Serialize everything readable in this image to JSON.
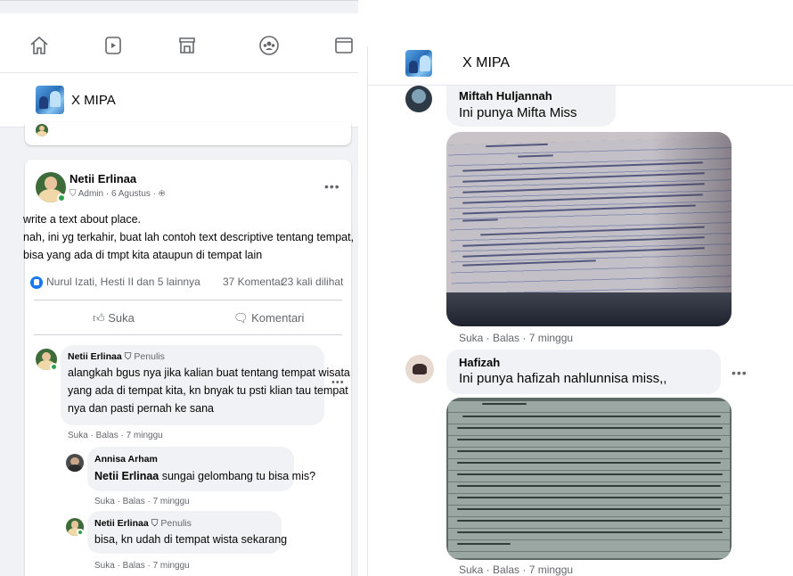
{
  "left_panel": {
    "nav": {
      "icons": [
        "home-icon",
        "watch-icon",
        "marketplace-icon",
        "groups-icon",
        "gaming-icon"
      ]
    },
    "group": {
      "name": "X MIPA"
    },
    "post": {
      "author": "Netii Erlinaa",
      "meta": "Admin · 6 Agustus · ",
      "text_lines": [
        "write a text about place.",
        "nah, ini yg terkahir, buat lah contoh text descriptive tentang tempat,",
        "bisa yang ada di tmpt kita ataupun di tempat lain"
      ],
      "reactions": "Nurul Izati, Hesti II dan 5 lainnya",
      "comments_count": "37 Komentar",
      "views": "23 kali dilihat",
      "like_label": "Suka",
      "comment_label": "Komentari"
    },
    "comments": [
      {
        "author": "Netii Erlinaa",
        "badge": "Penulis",
        "lines": [
          "alangkah bgus nya jika kalian buat tentang tempat wisata",
          "yang ada di tempat kita, kn bnyak tu psti klian tau tempat",
          "nya dan pasti pernah ke sana"
        ],
        "actions": "Suka · Balas · 7 minggu"
      },
      {
        "author": "Annisa Arham",
        "mention": "Netii Erlinaa",
        "text": " sungai gelombang tu bisa mis?",
        "actions": "Suka · Balas · 7 minggu"
      },
      {
        "author": "Netii Erlinaa",
        "badge": "Penulis",
        "text": "bisa, kn udah di tempat wista sekarang",
        "actions": "Suka · Balas · 7 minggu"
      }
    ]
  },
  "right_panel": {
    "group": {
      "name": "X MIPA"
    },
    "comments": [
      {
        "author": "Miftah Huljannah",
        "text": "Ini punya Mifta Miss",
        "actions": "Suka · Balas · 7 minggu"
      },
      {
        "author": "Hafizah",
        "text": "Ini punya hafizah nahlunnisa miss,,",
        "actions": "Suka · Balas · 7 minggu"
      }
    ]
  }
}
